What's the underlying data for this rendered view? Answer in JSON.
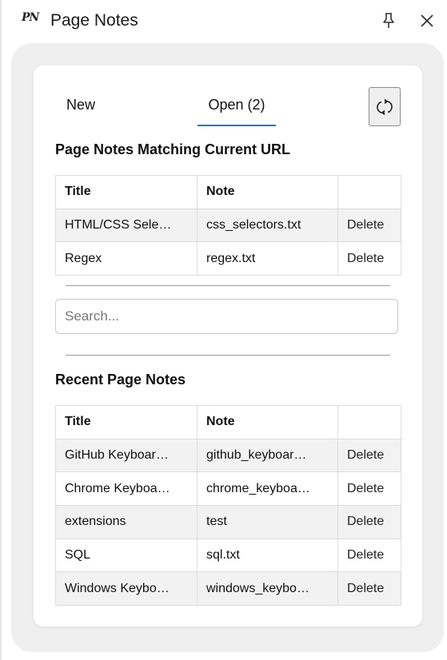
{
  "titlebar": {
    "logo_text": "PN",
    "title": "Page Notes"
  },
  "tabs": {
    "new_label": "New",
    "open_label": "Open (2)"
  },
  "matching": {
    "heading": "Page Notes Matching Current URL",
    "columns": [
      "Title",
      "Note",
      ""
    ],
    "rows": [
      {
        "title": "HTML/CSS Sele…",
        "note": "css_selectors.txt",
        "action": "Delete"
      },
      {
        "title": "Regex",
        "note": "regex.txt",
        "action": "Delete"
      }
    ]
  },
  "search": {
    "placeholder": "Search..."
  },
  "recent": {
    "heading": "Recent Page Notes",
    "columns": [
      "Title",
      "Note",
      ""
    ],
    "rows": [
      {
        "title": "GitHub Keyboar…",
        "note": "github_keyboar…",
        "action": "Delete"
      },
      {
        "title": "Chrome Keyboa…",
        "note": "chrome_keyboa…",
        "action": "Delete"
      },
      {
        "title": "extensions",
        "note": "test",
        "action": "Delete"
      },
      {
        "title": "SQL",
        "note": "sql.txt",
        "action": "Delete"
      },
      {
        "title": "Windows Keybo…",
        "note": "windows_keybo…",
        "action": "Delete"
      }
    ]
  },
  "icons": {
    "pin": "pin-icon",
    "close": "close-icon",
    "refresh": "refresh-icon"
  },
  "colors": {
    "accent": "#1a73c8",
    "panel": "#efefef",
    "row_alt": "#f2f2f2"
  }
}
